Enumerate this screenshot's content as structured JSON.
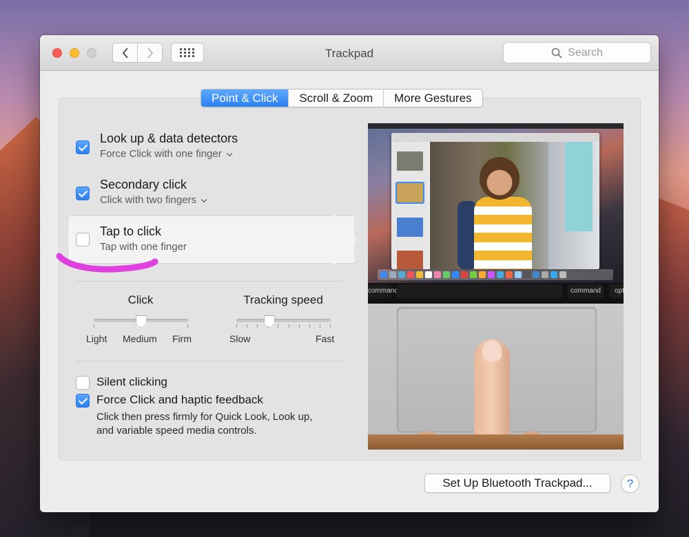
{
  "window": {
    "title": "Trackpad",
    "search_placeholder": "Search"
  },
  "tabs": [
    {
      "label": "Point & Click",
      "active": true
    },
    {
      "label": "Scroll & Zoom",
      "active": false
    },
    {
      "label": "More Gestures",
      "active": false
    }
  ],
  "options": [
    {
      "title": "Look up & data detectors",
      "subtitle": "Force Click with one finger",
      "checked": true,
      "has_menu": true
    },
    {
      "title": "Secondary click",
      "subtitle": "Click with two fingers",
      "checked": true,
      "has_menu": true
    },
    {
      "title": "Tap to click",
      "subtitle": "Tap with one finger",
      "checked": false,
      "has_menu": false
    }
  ],
  "sliders": {
    "click": {
      "label": "Click",
      "min_label": "Light",
      "mid_label": "Medium",
      "max_label": "Firm",
      "value": 0.5
    },
    "tracking": {
      "label": "Tracking speed",
      "min_label": "Slow",
      "max_label": "Fast",
      "value": 0.35
    }
  },
  "bottom_options": {
    "silent": {
      "label": "Silent clicking",
      "checked": false
    },
    "force": {
      "label": "Force Click and haptic feedback",
      "checked": true,
      "desc1": "Click then press firmly for Quick Look, Look up,",
      "desc2": "and variable speed media controls."
    }
  },
  "preview": {
    "key_left": "command",
    "key_right": "command",
    "key_far_right": "opt"
  },
  "footer": {
    "bluetooth_button": "Set Up Bluetooth Trackpad...",
    "help_label": "?"
  },
  "colors": {
    "accent": "#2b82f2",
    "annotation": "#e040e0"
  }
}
